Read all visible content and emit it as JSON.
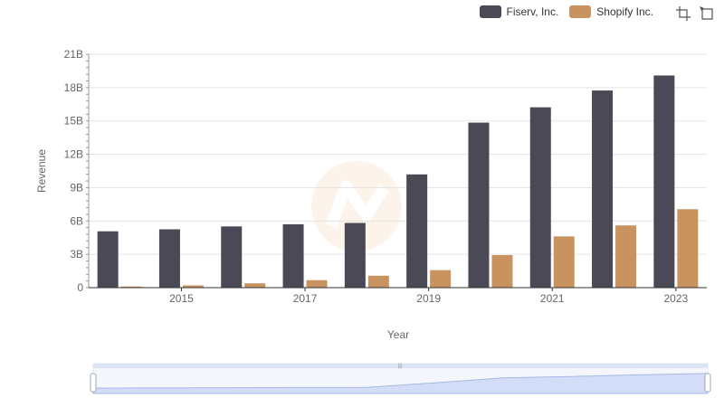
{
  "legend": [
    {
      "name": "Fiserv, Inc.",
      "color": "#4a4955"
    },
    {
      "name": "Shopify Inc.",
      "color": "#c9935f"
    }
  ],
  "toolbox": {
    "zoom_icon": "zoom-icon",
    "restore_icon": "restore-icon"
  },
  "chart_data": {
    "type": "bar",
    "categories": [
      "2014",
      "2015",
      "2016",
      "2017",
      "2018",
      "2019",
      "2020",
      "2021",
      "2022",
      "2023"
    ],
    "x_tick_labels": [
      "2015",
      "2017",
      "2019",
      "2021",
      "2023"
    ],
    "ylabel": "Revenue",
    "xlabel": "Year",
    "ylim": [
      0,
      21000000000
    ],
    "y_ticks": [
      {
        "value": 0,
        "label": "0"
      },
      {
        "value": 3000000000,
        "label": "3B"
      },
      {
        "value": 6000000000,
        "label": "6B"
      },
      {
        "value": 9000000000,
        "label": "9B"
      },
      {
        "value": 12000000000,
        "label": "12B"
      },
      {
        "value": 15000000000,
        "label": "15B"
      },
      {
        "value": 18000000000,
        "label": "18B"
      },
      {
        "value": 21000000000,
        "label": "21B"
      }
    ],
    "grid": true,
    "legend_position": "top-right",
    "series": [
      {
        "name": "Fiserv, Inc.",
        "color": "#4a4955",
        "values": [
          5070000000,
          5250000000,
          5510000000,
          5700000000,
          5820000000,
          10190000000,
          14850000000,
          16230000000,
          17740000000,
          19090000000
        ]
      },
      {
        "name": "Shopify Inc.",
        "color": "#c9935f",
        "values": [
          105000000,
          205000000,
          390000000,
          673000000,
          1073000000,
          1578000000,
          2929000000,
          4612000000,
          5600000000,
          7060000000
        ]
      }
    ]
  }
}
